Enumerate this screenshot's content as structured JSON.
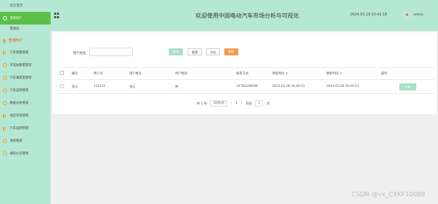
{
  "sidebar": {
    "home": "后台首页",
    "items": [
      {
        "label": "系统用户",
        "icon": "gear-icon",
        "active": true
      },
      {
        "label": "管理员",
        "sub": true
      },
      {
        "label": "普通用户",
        "header": true
      },
      {
        "label": "汽车销量管理",
        "icon": "bar-chart-icon"
      },
      {
        "label": "充电站数量管理",
        "icon": "gear-icon"
      },
      {
        "label": "汽车满意度管理",
        "icon": "gear-icon"
      },
      {
        "label": "汽车品牌管理",
        "icon": "gear-icon"
      },
      {
        "label": "数据分析管理",
        "icon": "gear-icon"
      },
      {
        "label": "地区充电管理",
        "icon": "bar-chart-icon"
      },
      {
        "label": "汽车品牌管理",
        "icon": "bar-chart-icon"
      },
      {
        "label": "系统管理",
        "icon": "gear-icon"
      },
      {
        "label": "通知公告管理",
        "icon": "gear-icon"
      }
    ]
  },
  "header": {
    "title": "欢迎使用中国电动汽车市场分析与可视化",
    "datetime": "2024.03.29 15:42:16",
    "user": "admin"
  },
  "search": {
    "label": "用户姓名",
    "placeholder": "",
    "query_label": "查询",
    "add_label": "重置",
    "delete_label": "添加",
    "export_label": "删除"
  },
  "table": {
    "headers": [
      "编号",
      "用户名",
      "用户姓名",
      "用户性别",
      "联系方式",
      "审核时间 ⇕",
      "更新时间 ⇕",
      "操作"
    ],
    "rows": [
      [
        "张三",
        "112233",
        "张三",
        "男",
        "14764238596",
        "2024-03-28 16:40:51",
        "2024-03-28 16:40:51"
      ]
    ],
    "row_action": "详情"
  },
  "pagination": {
    "total": "共 1 条",
    "page_size": "10条/页",
    "prev": "‹",
    "page": "1",
    "next": "›",
    "goto_label": "前往",
    "goto_value": "1",
    "goto_suffix": "页"
  },
  "watermark": "CSDN @vx_CXKF10088",
  "colors": {
    "sidebar": "#b5e8d4",
    "active": "#5cbf47",
    "export": "#f39c4a"
  }
}
